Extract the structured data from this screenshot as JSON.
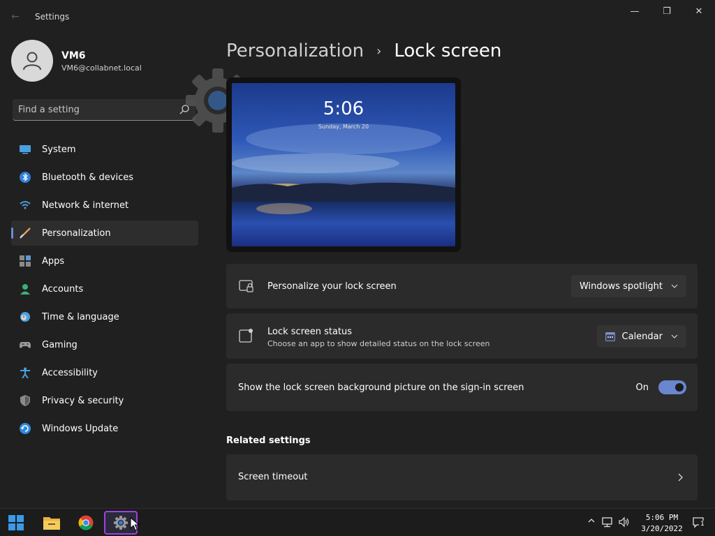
{
  "window": {
    "title": "Settings",
    "back_glyph": "←",
    "minimize_glyph": "—",
    "maximize_glyph": "❐",
    "close_glyph": "✕"
  },
  "profile": {
    "name": "VM6",
    "email": "VM6@collabnet.local"
  },
  "search": {
    "placeholder": "Find a setting",
    "icon": "search-icon"
  },
  "sidebar": {
    "items": [
      {
        "label": "System",
        "icon": "system-icon",
        "active": false
      },
      {
        "label": "Bluetooth & devices",
        "icon": "bluetooth-icon",
        "active": false
      },
      {
        "label": "Network & internet",
        "icon": "wifi-icon",
        "active": false
      },
      {
        "label": "Personalization",
        "icon": "brush-icon",
        "active": true
      },
      {
        "label": "Apps",
        "icon": "apps-icon",
        "active": false
      },
      {
        "label": "Accounts",
        "icon": "accounts-icon",
        "active": false
      },
      {
        "label": "Time & language",
        "icon": "clock-globe-icon",
        "active": false
      },
      {
        "label": "Gaming",
        "icon": "gamepad-icon",
        "active": false
      },
      {
        "label": "Accessibility",
        "icon": "accessibility-icon",
        "active": false
      },
      {
        "label": "Privacy & security",
        "icon": "shield-icon",
        "active": false
      },
      {
        "label": "Windows Update",
        "icon": "update-icon",
        "active": false
      }
    ]
  },
  "header": {
    "parent": "Personalization",
    "separator": "›",
    "current": "Lock screen"
  },
  "preview": {
    "time": "5:06",
    "date": "Sunday, March 20"
  },
  "settings": {
    "personalize": {
      "title": "Personalize your lock screen",
      "value": "Windows spotlight",
      "icon": "lock-screen-icon"
    },
    "status": {
      "title": "Lock screen status",
      "subtitle": "Choose an app to show detailed status on the lock screen",
      "value": "Calendar",
      "icon": "status-icon",
      "value_icon": "calendar-icon"
    },
    "signin_background": {
      "title": "Show the lock screen background picture on the sign-in screen",
      "state_label": "On",
      "enabled": true
    }
  },
  "related": {
    "header": "Related settings",
    "items": [
      {
        "label": "Screen timeout"
      }
    ]
  },
  "taskbar": {
    "apps": [
      "windows-start-icon",
      "file-explorer-icon",
      "chrome-icon",
      "settings-gear-icon"
    ],
    "active_app": "settings-gear-icon",
    "clock_time": "5:06 PM",
    "clock_date": "3/20/2022",
    "notification_count": "1"
  },
  "colors": {
    "background": "#202020",
    "card": "#2b2b2b",
    "accent": "#6a86cf",
    "taskbar_highlight": "#a040e0"
  }
}
